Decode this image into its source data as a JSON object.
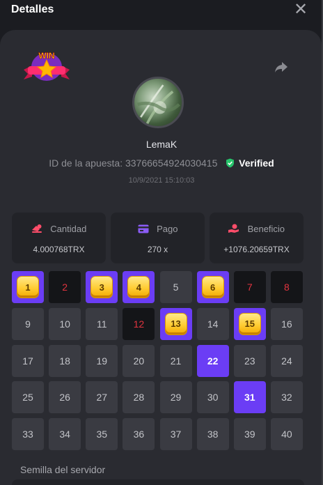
{
  "header": {
    "title": "Detalles",
    "close_icon": "close-icon"
  },
  "badge": {
    "label": "WIN"
  },
  "player": {
    "name": "LemaK"
  },
  "bet": {
    "id_text": "ID de la apuesta: 33766654924030415",
    "verified_label": "Verified",
    "datetime": "10/9/2021 15:10:03"
  },
  "stats": [
    {
      "label": "Cantidad",
      "value": "4.000768TRX",
      "icon": "coins-icon",
      "color": "#ff4d6a"
    },
    {
      "label": "Pago",
      "value": "270 x",
      "icon": "card-icon",
      "color": "#8b5cf6"
    },
    {
      "label": "Beneficio",
      "value": "+1076.20659TRX",
      "icon": "hand-coin-icon",
      "color": "#ff4d6a"
    }
  ],
  "grid": [
    {
      "n": "1",
      "s": "gold"
    },
    {
      "n": "2",
      "s": "dark"
    },
    {
      "n": "3",
      "s": "gold"
    },
    {
      "n": "4",
      "s": "gold"
    },
    {
      "n": "5",
      "s": "normal"
    },
    {
      "n": "6",
      "s": "gold"
    },
    {
      "n": "7",
      "s": "dark"
    },
    {
      "n": "8",
      "s": "dark"
    },
    {
      "n": "9",
      "s": "normal"
    },
    {
      "n": "10",
      "s": "normal"
    },
    {
      "n": "11",
      "s": "normal"
    },
    {
      "n": "12",
      "s": "dark"
    },
    {
      "n": "13",
      "s": "gold"
    },
    {
      "n": "14",
      "s": "normal"
    },
    {
      "n": "15",
      "s": "gold"
    },
    {
      "n": "16",
      "s": "normal"
    },
    {
      "n": "17",
      "s": "normal"
    },
    {
      "n": "18",
      "s": "normal"
    },
    {
      "n": "19",
      "s": "normal"
    },
    {
      "n": "20",
      "s": "normal"
    },
    {
      "n": "21",
      "s": "normal"
    },
    {
      "n": "22",
      "s": "sel"
    },
    {
      "n": "23",
      "s": "normal"
    },
    {
      "n": "24",
      "s": "normal"
    },
    {
      "n": "25",
      "s": "normal"
    },
    {
      "n": "26",
      "s": "normal"
    },
    {
      "n": "27",
      "s": "normal"
    },
    {
      "n": "28",
      "s": "normal"
    },
    {
      "n": "29",
      "s": "normal"
    },
    {
      "n": "30",
      "s": "normal"
    },
    {
      "n": "31",
      "s": "sel"
    },
    {
      "n": "32",
      "s": "normal"
    },
    {
      "n": "33",
      "s": "normal"
    },
    {
      "n": "34",
      "s": "normal"
    },
    {
      "n": "35",
      "s": "normal"
    },
    {
      "n": "36",
      "s": "normal"
    },
    {
      "n": "37",
      "s": "normal"
    },
    {
      "n": "38",
      "s": "normal"
    },
    {
      "n": "39",
      "s": "normal"
    },
    {
      "n": "40",
      "s": "normal"
    }
  ],
  "seed": {
    "label": "Semilla del servidor"
  },
  "colors": {
    "accent": "#6b3df5",
    "gold": "#ffcc33",
    "miss": "#e2343f",
    "verified": "#27c46b"
  }
}
